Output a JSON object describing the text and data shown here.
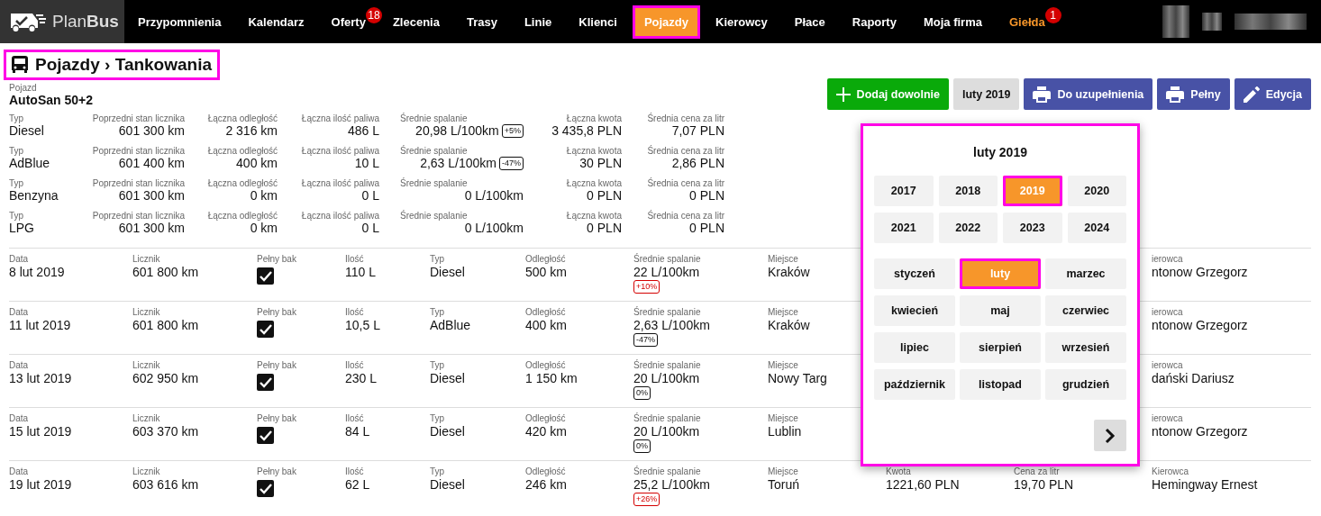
{
  "nav": {
    "logo": {
      "light": "Plan",
      "bold": "Bus"
    },
    "items": [
      {
        "label": "Przypomnienia",
        "selected": false,
        "accent": false
      },
      {
        "label": "Kalendarz",
        "selected": false,
        "accent": false
      },
      {
        "label": "Oferty",
        "selected": false,
        "accent": false,
        "badge": "18"
      },
      {
        "label": "Zlecenia",
        "selected": false,
        "accent": false
      },
      {
        "label": "Trasy",
        "selected": false,
        "accent": false
      },
      {
        "label": "Linie",
        "selected": false,
        "accent": false
      },
      {
        "label": "Klienci",
        "selected": false,
        "accent": false
      },
      {
        "label": "Pojazdy",
        "selected": true,
        "accent": false
      },
      {
        "label": "Kierowcy",
        "selected": false,
        "accent": false
      },
      {
        "label": "Płace",
        "selected": false,
        "accent": false
      },
      {
        "label": "Raporty",
        "selected": false,
        "accent": false
      },
      {
        "label": "Moja firma",
        "selected": false,
        "accent": false
      },
      {
        "label": "Giełda",
        "selected": false,
        "accent": true,
        "badge": "1"
      }
    ]
  },
  "page_title": "Pojazdy › Tankowania",
  "vehicle": {
    "label": "Pojazd",
    "value": "AutoSan 50+2"
  },
  "actions": [
    {
      "kind": "add",
      "label": "Dodaj dowolnie"
    },
    {
      "kind": "period",
      "label": "luty 2019"
    },
    {
      "kind": "print",
      "label": "Do uzupełnienia"
    },
    {
      "kind": "print",
      "label": "Pełny"
    },
    {
      "kind": "edit",
      "label": "Edycja"
    }
  ],
  "summary": [
    {
      "cells": [
        {
          "label": "Typ",
          "value": "Diesel"
        },
        {
          "label": "Poprzedni stan licznika",
          "value": "601 300 km"
        },
        {
          "label": "Łączna odległość",
          "value": "2 316 km"
        },
        {
          "label": "Łączna ilość paliwa",
          "value": "486 L"
        },
        {
          "label": "Średnie spalanie",
          "value": "20,98 L/100km",
          "badge": {
            "text": "+5%",
            "alert": false
          }
        },
        {
          "label": "Łączna kwota",
          "value": "3 435,8 PLN"
        },
        {
          "label": "Średnia cena za litr",
          "value": "7,07 PLN"
        }
      ]
    },
    {
      "cells": [
        {
          "label": "Typ",
          "value": "AdBlue"
        },
        {
          "label": "Poprzedni stan licznika",
          "value": "601 400 km"
        },
        {
          "label": "Łączna odległość",
          "value": "400 km"
        },
        {
          "label": "Łączna ilość paliwa",
          "value": "10 L"
        },
        {
          "label": "Średnie spalanie",
          "value": "2,63 L/100km",
          "badge": {
            "text": "-47%",
            "alert": false
          }
        },
        {
          "label": "Łączna kwota",
          "value": "30 PLN"
        },
        {
          "label": "Średnia cena za litr",
          "value": "2,86 PLN"
        }
      ]
    },
    {
      "cells": [
        {
          "label": "Typ",
          "value": "Benzyna"
        },
        {
          "label": "Poprzedni stan licznika",
          "value": "601 300 km"
        },
        {
          "label": "Łączna odległość",
          "value": "0 km"
        },
        {
          "label": "Łączna ilość paliwa",
          "value": "0 L"
        },
        {
          "label": "Średnie spalanie",
          "value": "0 L/100km"
        },
        {
          "label": "Łączna kwota",
          "value": "0 PLN"
        },
        {
          "label": "Średnia cena za litr",
          "value": "0 PLN"
        }
      ]
    },
    {
      "cells": [
        {
          "label": "Typ",
          "value": "LPG"
        },
        {
          "label": "Poprzedni stan licznika",
          "value": "601 300 km"
        },
        {
          "label": "Łączna odległość",
          "value": "0 km"
        },
        {
          "label": "Łączna ilość paliwa",
          "value": "0 L"
        },
        {
          "label": "Średnie spalanie",
          "value": "0 L/100km"
        },
        {
          "label": "Łączna kwota",
          "value": "0 PLN"
        },
        {
          "label": "Średnia cena za litr",
          "value": "0 PLN"
        }
      ]
    }
  ],
  "entries": [
    {
      "cells": [
        {
          "kind": "text",
          "label": "Data",
          "value": "8 lut 2019"
        },
        {
          "kind": "text",
          "label": "Licznik",
          "value": "601 800 km"
        },
        {
          "kind": "check",
          "label": "Pełny bak",
          "checked": true
        },
        {
          "kind": "text",
          "label": "Ilość",
          "value": "110 L"
        },
        {
          "kind": "text",
          "label": "Typ",
          "value": "Diesel"
        },
        {
          "kind": "text",
          "label": "Odległość",
          "value": "500 km"
        },
        {
          "kind": "text",
          "label": "Średnie spalanie",
          "value": "22 L/100km",
          "badge": {
            "text": "+10%",
            "alert": true
          }
        },
        {
          "kind": "text",
          "label": "Miejsce",
          "value": "Kraków"
        },
        {
          "kind": "driver",
          "label": "ierowca",
          "value": "ntonow Grzegorz"
        }
      ]
    },
    {
      "cells": [
        {
          "kind": "text",
          "label": "Data",
          "value": "11 lut 2019"
        },
        {
          "kind": "text",
          "label": "Licznik",
          "value": "601 800 km"
        },
        {
          "kind": "check",
          "label": "Pełny bak",
          "checked": true
        },
        {
          "kind": "text",
          "label": "Ilość",
          "value": "10,5 L"
        },
        {
          "kind": "text",
          "label": "Typ",
          "value": "AdBlue"
        },
        {
          "kind": "text",
          "label": "Odległość",
          "value": "400 km"
        },
        {
          "kind": "text",
          "label": "Średnie spalanie",
          "value": "2,63 L/100km",
          "badge": {
            "text": "-47%",
            "alert": false
          }
        },
        {
          "kind": "text",
          "label": "Miejsce",
          "value": "Kraków"
        },
        {
          "kind": "driver",
          "label": "ierowca",
          "value": "ntonow Grzegorz"
        }
      ]
    },
    {
      "cells": [
        {
          "kind": "text",
          "label": "Data",
          "value": "13 lut 2019"
        },
        {
          "kind": "text",
          "label": "Licznik",
          "value": "602 950 km"
        },
        {
          "kind": "check",
          "label": "Pełny bak",
          "checked": true
        },
        {
          "kind": "text",
          "label": "Ilość",
          "value": "230 L"
        },
        {
          "kind": "text",
          "label": "Typ",
          "value": "Diesel"
        },
        {
          "kind": "text",
          "label": "Odległość",
          "value": "1 150 km"
        },
        {
          "kind": "text",
          "label": "Średnie spalanie",
          "value": "20 L/100km",
          "badge": {
            "text": "0%",
            "alert": false
          }
        },
        {
          "kind": "text",
          "label": "Miejsce",
          "value": "Nowy Targ"
        },
        {
          "kind": "driver",
          "label": "ierowca",
          "value": "dański Dariusz"
        }
      ]
    },
    {
      "cells": [
        {
          "kind": "text",
          "label": "Data",
          "value": "15 lut 2019"
        },
        {
          "kind": "text",
          "label": "Licznik",
          "value": "603 370 km"
        },
        {
          "kind": "check",
          "label": "Pełny bak",
          "checked": true
        },
        {
          "kind": "text",
          "label": "Ilość",
          "value": "84 L"
        },
        {
          "kind": "text",
          "label": "Typ",
          "value": "Diesel"
        },
        {
          "kind": "text",
          "label": "Odległość",
          "value": "420 km"
        },
        {
          "kind": "text",
          "label": "Średnie spalanie",
          "value": "20 L/100km",
          "badge": {
            "text": "0%",
            "alert": false
          }
        },
        {
          "kind": "text",
          "label": "Miejsce",
          "value": "Lublin"
        },
        {
          "kind": "driver",
          "label": "ierowca",
          "value": "ntonow Grzegorz"
        }
      ]
    },
    {
      "cells": [
        {
          "kind": "text",
          "label": "Data",
          "value": "19 lut 2019"
        },
        {
          "kind": "text",
          "label": "Licznik",
          "value": "603 616 km"
        },
        {
          "kind": "check",
          "label": "Pełny bak",
          "checked": true
        },
        {
          "kind": "text",
          "label": "Ilość",
          "value": "62 L"
        },
        {
          "kind": "text",
          "label": "Typ",
          "value": "Diesel"
        },
        {
          "kind": "text",
          "label": "Odległość",
          "value": "246 km"
        },
        {
          "kind": "text",
          "label": "Średnie spalanie",
          "value": "25,2 L/100km",
          "badge": {
            "text": "+26%",
            "alert": true
          }
        },
        {
          "kind": "text",
          "label": "Miejsce",
          "value": "Toruń"
        },
        {
          "kind": "text",
          "label": "Kwota",
          "value": "1221,60 PLN"
        },
        {
          "kind": "text",
          "label": "Cena za litr",
          "value": "19,70 PLN"
        },
        {
          "kind": "driver",
          "label": "Kierowca",
          "value": "Hemingway Ernest"
        }
      ]
    }
  ],
  "picker": {
    "title": "luty 2019",
    "years": [
      {
        "label": "2017",
        "selected": false
      },
      {
        "label": "2018",
        "selected": false
      },
      {
        "label": "2019",
        "selected": true
      },
      {
        "label": "2020",
        "selected": false
      },
      {
        "label": "2021",
        "selected": false
      },
      {
        "label": "2022",
        "selected": false
      },
      {
        "label": "2023",
        "selected": false
      },
      {
        "label": "2024",
        "selected": false
      }
    ],
    "months": [
      {
        "label": "styczeń",
        "selected": false
      },
      {
        "label": "luty",
        "selected": true
      },
      {
        "label": "marzec",
        "selected": false
      },
      {
        "label": "kwiecień",
        "selected": false
      },
      {
        "label": "maj",
        "selected": false
      },
      {
        "label": "czerwiec",
        "selected": false
      },
      {
        "label": "lipiec",
        "selected": false
      },
      {
        "label": "sierpień",
        "selected": false
      },
      {
        "label": "wrzesień",
        "selected": false
      },
      {
        "label": "październik",
        "selected": false
      },
      {
        "label": "listopad",
        "selected": false
      },
      {
        "label": "grudzień",
        "selected": false
      }
    ]
  }
}
